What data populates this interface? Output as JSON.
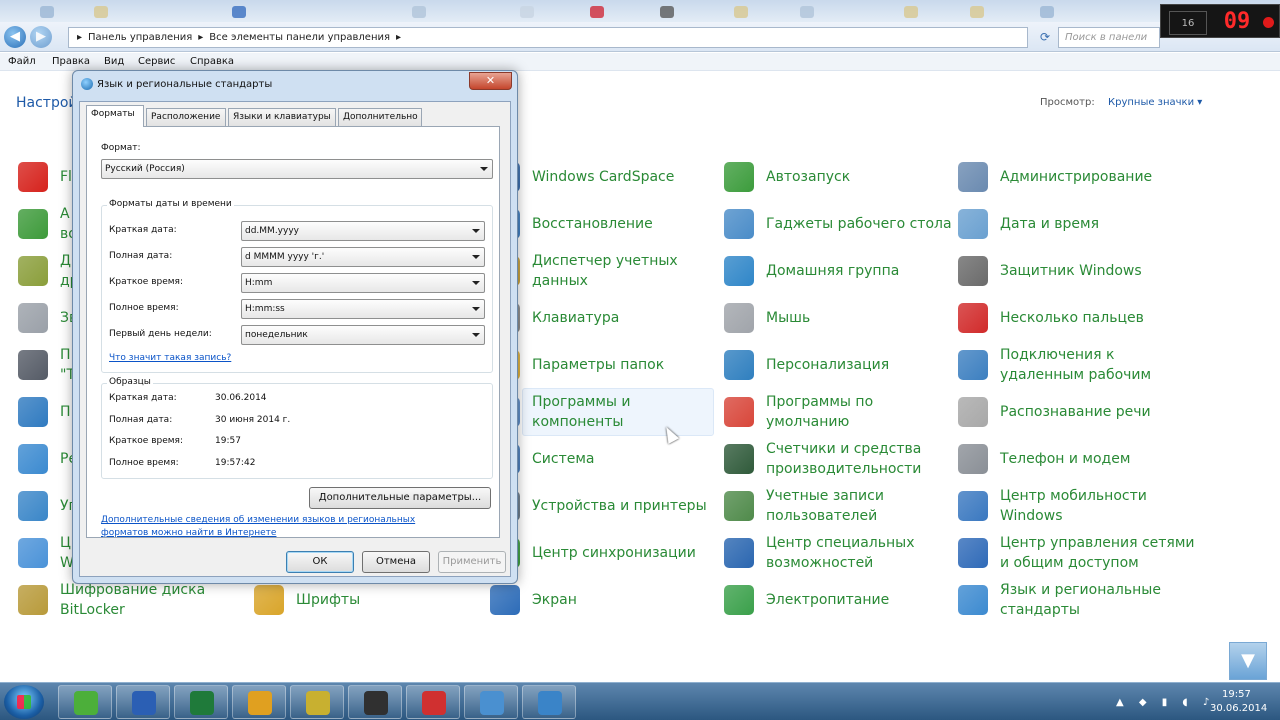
{
  "explorer": {
    "breadcrumb": [
      "Панель управления",
      "Все элементы панели управления"
    ],
    "search_placeholder": "Поиск в панели управления",
    "menu": [
      "Файл",
      "Правка",
      "Вид",
      "Сервис",
      "Справка"
    ],
    "header_title": "Настрой",
    "view_label": "Просмотр:",
    "view_value": "Крупные значки"
  },
  "recorder": {
    "fps": "16",
    "counter": "09"
  },
  "items": {
    "c1": [
      {
        "label": "Fl",
        "color": "#d6221c"
      },
      {
        "label": "А\nво",
        "color": "#3d9a3a"
      },
      {
        "label": "Д\nдр",
        "color": "#8a9e3a"
      },
      {
        "label": "Зв",
        "color": "#9aa0a8"
      },
      {
        "label": "П\n\"Т",
        "color": "#555b66"
      },
      {
        "label": "П",
        "color": "#2f7ac0"
      },
      {
        "label": "Ре",
        "color": "#3b8ad0"
      },
      {
        "label": "Уп",
        "color": "#3a86c8"
      },
      {
        "label": "Ц\nW",
        "color": "#4a92d8"
      },
      {
        "label": "Шифрование диска\nBitLocker",
        "color": "#b89a3a"
      }
    ],
    "c2": [
      {
        "label": "Шрифты",
        "color": "#d9a52a"
      }
    ],
    "c3": [
      {
        "label": "Windows CardSpace",
        "color": "#3a6fb0"
      },
      {
        "label": "Восстановление",
        "color": "#3d7ec2"
      },
      {
        "label": "Диспетчер учетных\nданных",
        "color": "#c9a13a"
      },
      {
        "label": "Клавиатура",
        "color": "#8c8c8c"
      },
      {
        "label": "Параметры папок",
        "color": "#e1b23a"
      },
      {
        "label": "Программы и\nкомпоненты",
        "color": "#5b8cc8"
      },
      {
        "label": "Система",
        "color": "#4a7fbf"
      },
      {
        "label": "Устройства и принтеры",
        "color": "#6b7c8c"
      },
      {
        "label": "Центр синхронизации",
        "color": "#3ca040"
      },
      {
        "label": "Экран",
        "color": "#2d6cb8"
      }
    ],
    "c4": [
      {
        "label": "Автозапуск",
        "color": "#3c9c3c"
      },
      {
        "label": "Гаджеты рабочего стола",
        "color": "#4a8cc8"
      },
      {
        "label": "Домашняя группа",
        "color": "#2f86c8"
      },
      {
        "label": "Мышь",
        "color": "#a0a4aa"
      },
      {
        "label": "Персонализация",
        "color": "#2f7fbf"
      },
      {
        "label": "Программы по\nумолчанию",
        "color": "#d8463a"
      },
      {
        "label": "Счетчики и средства\nпроизводительности",
        "color": "#2f5a3a"
      },
      {
        "label": "Учетные записи\nпользователей",
        "color": "#4f8a4a"
      },
      {
        "label": "Центр специальных\nвозможностей",
        "color": "#2a66b0"
      },
      {
        "label": "Электропитание",
        "color": "#3aa04a"
      }
    ],
    "c5": [
      {
        "label": "Администрирование",
        "color": "#6a8ab0"
      },
      {
        "label": "Дата и время",
        "color": "#6aa0d0"
      },
      {
        "label": "Защитник Windows",
        "color": "#6a6a6a"
      },
      {
        "label": "Несколько пальцев",
        "color": "#d12a2a"
      },
      {
        "label": "Подключения к\nудаленным рабочим",
        "color": "#3c7fc0"
      },
      {
        "label": "Распознавание речи",
        "color": "#a8a8a8"
      },
      {
        "label": "Телефон и модем",
        "color": "#8a8f96"
      },
      {
        "label": "Центр мобильности\nWindows",
        "color": "#3a78c0"
      },
      {
        "label": "Центр управления сетями\nи общим доступом",
        "color": "#2f6ab8"
      },
      {
        "label": "Язык и региональные\nстандарты",
        "color": "#3c8ad0"
      }
    ]
  },
  "dialog": {
    "title": "Язык и региональные стандарты",
    "close": "✕",
    "tabs": [
      "Форматы",
      "Расположение",
      "Языки и клавиатуры",
      "Дополнительно"
    ],
    "format_label": "Формат:",
    "format_value": "Русский (Россия)",
    "dt_group": "Форматы даты и времени",
    "rows": [
      {
        "label": "Краткая дата:",
        "value": "dd.MM.yyyy"
      },
      {
        "label": "Полная дата:",
        "value": "d MMMM yyyy 'г.'"
      },
      {
        "label": "Краткое время:",
        "value": "H:mm"
      },
      {
        "label": "Полное время:",
        "value": "H:mm:ss"
      },
      {
        "label": "Первый день недели:",
        "value": "понедельник"
      }
    ],
    "meaning_link": "Что значит такая запись?",
    "samples_title": "Образцы",
    "samples": [
      {
        "label": "Краткая дата:",
        "value": "30.06.2014"
      },
      {
        "label": "Полная дата:",
        "value": "30 июня 2014 г."
      },
      {
        "label": "Краткое время:",
        "value": "19:57"
      },
      {
        "label": "Полное время:",
        "value": "19:57:42"
      }
    ],
    "additional_btn": "Дополнительные параметры...",
    "info_link_1": "Дополнительные сведения об изменении языков и региональных",
    "info_link_2": "форматов можно найти в Интернете",
    "ok": "ОК",
    "cancel": "Отмена",
    "apply": "Применить"
  },
  "taskbar": {
    "apps": [
      {
        "name": "utorrent",
        "color": "#4caf3a"
      },
      {
        "name": "word",
        "color": "#2b5fb4"
      },
      {
        "name": "excel",
        "color": "#1f7a3a"
      },
      {
        "name": "chrome",
        "color": "#e0a020"
      },
      {
        "name": "tool",
        "color": "#c8b030"
      },
      {
        "name": "bandicam",
        "color": "#303030"
      },
      {
        "name": "record",
        "color": "#d03030"
      },
      {
        "name": "control-panel",
        "color": "#4a90d0"
      },
      {
        "name": "region",
        "color": "#3a84c8"
      }
    ],
    "time": "19:57",
    "date": "30.06.2014"
  }
}
